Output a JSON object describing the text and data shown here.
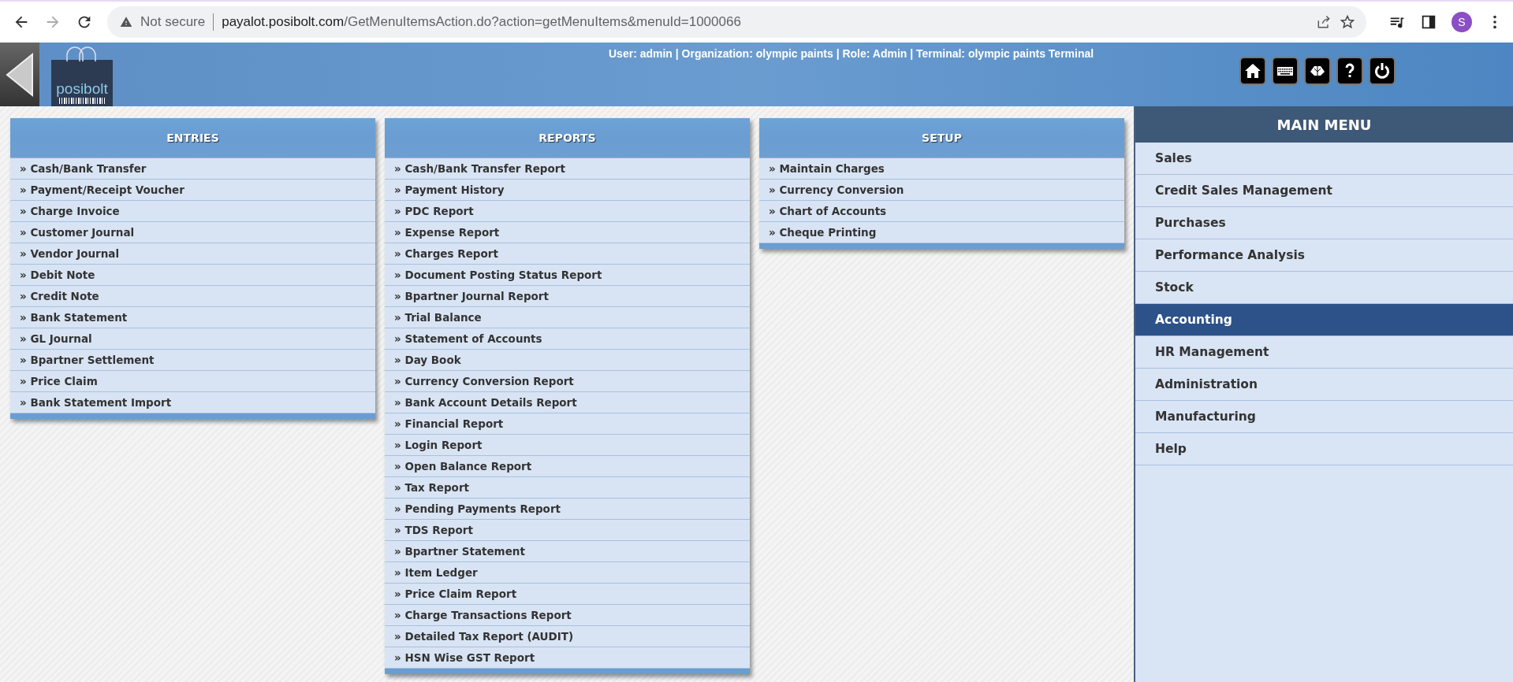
{
  "browser": {
    "forward_disabled": true,
    "security": "Not secure",
    "url_host": "payalot.posibolt.com",
    "url_path": "/GetMenuItemsAction.do?action=getMenuItems&menuId=1000066",
    "avatar": "S"
  },
  "header": {
    "logo_text": "posibolt",
    "user_info": "User: admin | Organization: olympic paints | Role: Admin | Terminal: olympic paints Terminal"
  },
  "panels": [
    {
      "title": "ENTRIES",
      "items": [
        "» Cash/Bank Transfer",
        "» Payment/Receipt Voucher",
        "» Charge Invoice",
        "» Customer Journal",
        "» Vendor Journal",
        "» Debit Note",
        "» Credit Note",
        "» Bank Statement",
        "» GL Journal",
        "» Bpartner Settlement",
        "» Price Claim",
        "» Bank Statement Import"
      ]
    },
    {
      "title": "REPORTS",
      "items": [
        "» Cash/Bank Transfer Report",
        "» Payment History",
        "» PDC Report",
        "» Expense Report",
        "» Charges Report",
        "» Document Posting Status Report",
        "» Bpartner Journal Report",
        "» Trial Balance",
        "» Statement of Accounts",
        "» Day Book",
        "» Currency Conversion Report",
        "» Bank Account Details Report",
        "» Financial Report",
        "» Login Report",
        "» Open Balance Report",
        "» Tax Report",
        "» Pending Payments Report",
        "» TDS Report",
        "» Bpartner Statement",
        "» Item Ledger",
        "» Price Claim Report",
        "» Charge Transactions Report",
        "» Detailed Tax Report (AUDIT)",
        "» HSN Wise GST Report"
      ]
    },
    {
      "title": "SETUP",
      "items": [
        "» Maintain Charges",
        "» Currency Conversion",
        "» Chart of Accounts",
        "» Cheque Printing"
      ]
    }
  ],
  "main_menu": {
    "title": "MAIN MENU",
    "items": [
      {
        "label": "Sales",
        "selected": false
      },
      {
        "label": "Credit Sales Management",
        "selected": false
      },
      {
        "label": "Purchases",
        "selected": false
      },
      {
        "label": "Performance Analysis",
        "selected": false
      },
      {
        "label": "Stock",
        "selected": false
      },
      {
        "label": "Accounting",
        "selected": true
      },
      {
        "label": "HR Management",
        "selected": false
      },
      {
        "label": "Administration",
        "selected": false
      },
      {
        "label": "Manufacturing",
        "selected": false
      },
      {
        "label": "Help",
        "selected": false
      }
    ]
  }
}
